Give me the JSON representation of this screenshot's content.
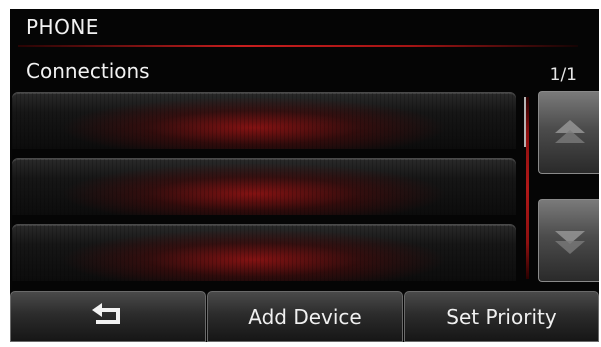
{
  "header": {
    "title": "PHONE"
  },
  "section": {
    "title": "Connections",
    "page_indicator": "1/1"
  },
  "device_list": {
    "slots": [
      {
        "label": ""
      },
      {
        "label": ""
      },
      {
        "label": ""
      }
    ]
  },
  "scroll": {
    "up_icon": "double-chevron-up-icon",
    "down_icon": "double-chevron-down-icon"
  },
  "bottom_bar": {
    "back_icon": "return-arrow-icon",
    "add_device_label": "Add Device",
    "set_priority_label": "Set Priority"
  },
  "colors": {
    "accent_red": "#c81e1e",
    "background": "#050505",
    "text": "#f2f2f2"
  }
}
